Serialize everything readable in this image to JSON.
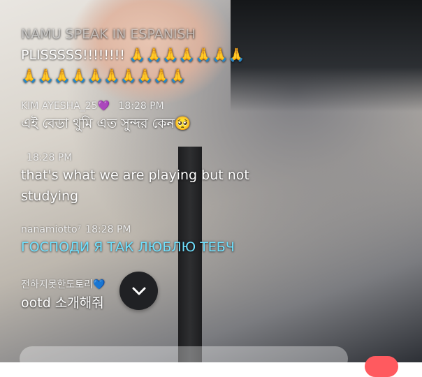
{
  "messages": [
    {
      "lines": [
        "NAMU SPEAK IN ESPANISH",
        "PLISSSSS!!!!!!!! 🙏🙏🙏🙏🙏🙏🙏",
        "🙏🙏🙏🙏🙏🙏🙏🙏🙏🙏"
      ]
    },
    {
      "username": "KIM AYESHA_25",
      "username_emoji": "💜",
      "time": "18:28 PM",
      "text": "এই বেডা থুমি এত সুন্দর কেন🥺"
    },
    {
      "username": "",
      "time": "18:28 PM",
      "text_lines": [
        "that's what we are playing but not",
        "studying"
      ]
    },
    {
      "username": "nanamiotto⁷",
      "time": "18:28 PM",
      "text": "ГОСПОДИ Я ТАК ЛЮБЛЮ ТЕБЧ"
    },
    {
      "username": "전하지못한도토리",
      "username_emoji": "💙",
      "time": "PM",
      "text": "ootd 소개해줘"
    }
  ],
  "colors": {
    "highlight_text": "#6fe1ff",
    "scroll_button_bg": "#202124",
    "react_button": "#ff5a5f"
  },
  "icons": {
    "scroll_down": "chevron-down-icon"
  }
}
